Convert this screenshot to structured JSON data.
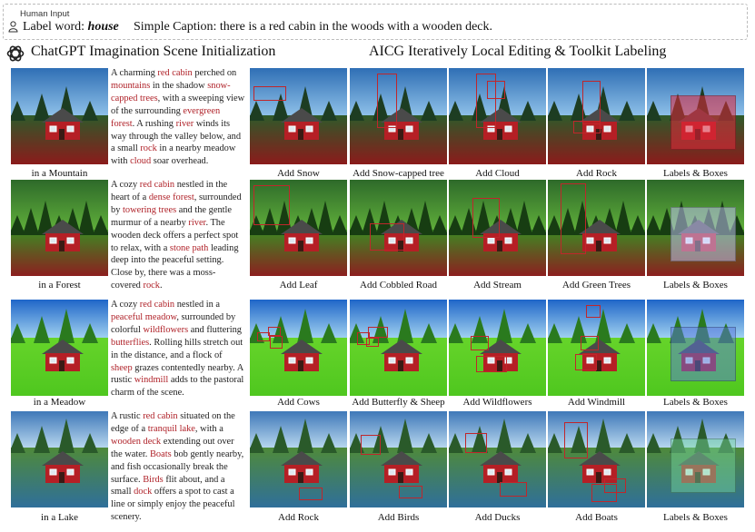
{
  "header": {
    "human_input": "Human Input",
    "label_prefix": "Label word: ",
    "label_word": "house",
    "caption_prefix": "Simple Caption: ",
    "caption_text": "there is a red cabin in the woods with a wooden deck."
  },
  "left_title": "ChatGPT Imagination Scene Initialization",
  "right_title": "AICG Iteratively Local Editing & Toolkit Labeling",
  "rows": [
    {
      "scene_caption": "in a Mountain",
      "description": [
        {
          "t": "A charming "
        },
        {
          "t": "red cabin",
          "red": true
        },
        {
          "t": " perched on "
        },
        {
          "t": "mountains",
          "red": true
        },
        {
          "t": " in the shadow "
        },
        {
          "t": "snow-capped trees",
          "red": true
        },
        {
          "t": ", with a sweeping view of the surrounding "
        },
        {
          "t": "evergreen forest",
          "red": true
        },
        {
          "t": ". A rushing "
        },
        {
          "t": "river",
          "red": true
        },
        {
          "t": " winds its way through the valley below, and a small "
        },
        {
          "t": "rock",
          "red": true
        },
        {
          "t": " in a nearby meadow with "
        },
        {
          "t": "cloud",
          "red": true
        },
        {
          "t": " soar overhead."
        }
      ],
      "steps": [
        "Add Snow",
        "Add Snow-capped tree",
        "Add Cloud",
        "Add Rock",
        "Labels & Boxes"
      ]
    },
    {
      "scene_caption": "in a Forest",
      "description": [
        {
          "t": "A cozy "
        },
        {
          "t": "red cabin",
          "red": true
        },
        {
          "t": " nestled in the heart of a "
        },
        {
          "t": "dense forest",
          "red": true
        },
        {
          "t": ", surrounded by "
        },
        {
          "t": "towering trees",
          "red": true
        },
        {
          "t": " and the gentle murmur of a nearby "
        },
        {
          "t": "river",
          "red": true
        },
        {
          "t": ". The wooden deck offers a perfect spot to relax, with a "
        },
        {
          "t": "stone path",
          "red": true
        },
        {
          "t": " leading deep into the peaceful setting. Close by, there was a moss-covered "
        },
        {
          "t": "rock",
          "red": true
        },
        {
          "t": "."
        }
      ],
      "steps": [
        "Add Leaf",
        "Add Cobbled Road",
        "Add Stream",
        "Add Green Trees",
        "Labels & Boxes"
      ]
    },
    {
      "scene_caption": "in a Meadow",
      "description": [
        {
          "t": "A cozy "
        },
        {
          "t": "red cabin",
          "red": true
        },
        {
          "t": " nestled in a "
        },
        {
          "t": "peaceful meadow",
          "red": true
        },
        {
          "t": ", surrounded by colorful "
        },
        {
          "t": "wildflowers",
          "red": true
        },
        {
          "t": " and fluttering "
        },
        {
          "t": "butterflies",
          "red": true
        },
        {
          "t": ". Rolling hills stretch out in the distance, and a flock of "
        },
        {
          "t": "sheep",
          "red": true
        },
        {
          "t": " grazes contentedly nearby. A rustic "
        },
        {
          "t": "windmill",
          "red": true
        },
        {
          "t": " adds to the pastoral charm of the scene."
        }
      ],
      "steps": [
        "Add Cows",
        "Add Butterfly & Sheep",
        "Add Wildflowers",
        "Add Windmill",
        "Labels & Boxes"
      ]
    },
    {
      "scene_caption": "in a Lake",
      "description": [
        {
          "t": "A rustic "
        },
        {
          "t": "red cabin",
          "red": true
        },
        {
          "t": " situated on the edge of a "
        },
        {
          "t": "tranquil lake",
          "red": true
        },
        {
          "t": ", with a "
        },
        {
          "t": "wooden deck",
          "red": true
        },
        {
          "t": " extending out over the water. "
        },
        {
          "t": "Boats",
          "red": true
        },
        {
          "t": " bob gently nearby, and fish occasionally break the surface. "
        },
        {
          "t": "Birds",
          "red": true
        },
        {
          "t": " flit about, and a small "
        },
        {
          "t": "dock",
          "red": true
        },
        {
          "t": " offers a spot to cast a line or simply enjoy the peaceful scenery."
        }
      ],
      "steps": [
        "Add Rock",
        "Add Birds",
        "Add Ducks",
        "Add Boats",
        "Labels & Boxes"
      ]
    }
  ],
  "colors": {
    "accent_red": "#c0262b",
    "cabin_red": "#b51f25",
    "text_red": "#b0232a"
  }
}
